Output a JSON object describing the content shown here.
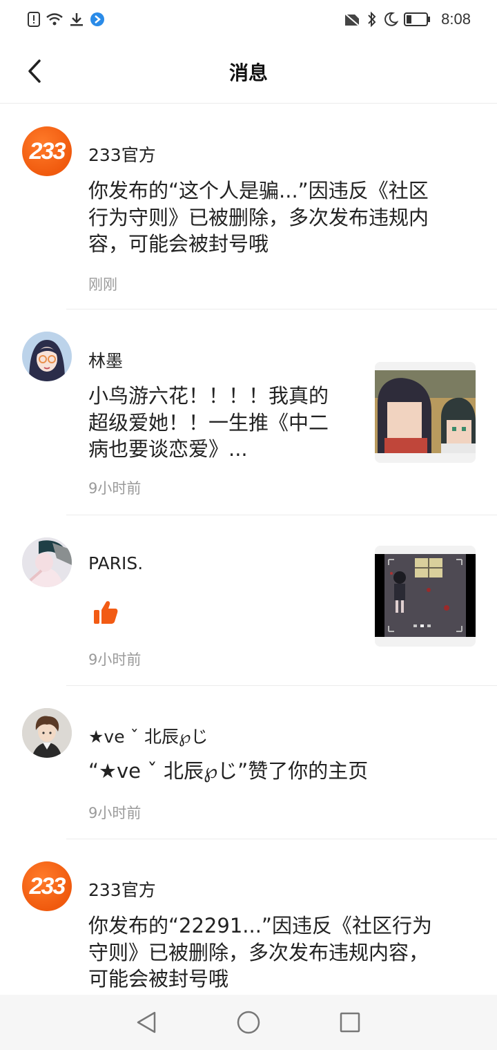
{
  "status_bar": {
    "time": "8:08",
    "left_icons": [
      "alert-icon",
      "wifi-icon",
      "download-icon",
      "app-notify-icon"
    ],
    "right_icons": [
      "no-sim-icon",
      "bluetooth-icon",
      "do-not-disturb-icon",
      "battery-icon"
    ]
  },
  "header": {
    "title": "消息",
    "back_icon": "chevron-left-icon"
  },
  "messages": [
    {
      "sender": "233官方",
      "avatar_text": "233",
      "body": "你发布的“这个人是骗...”因违反《社区行为守则》已被删除，多次发布违规内容，可能会被封号哦",
      "time": "刚刚"
    },
    {
      "sender": "林墨",
      "body": "小鸟游六花！！！！我真的超级爱她！！一生推《中二病也要谈恋爱》...",
      "time": "9小时前"
    },
    {
      "sender": "PARIS.⁣",
      "like_icon": "thumbs-up-icon",
      "time": "9小时前"
    },
    {
      "sender": "★ve ˇ 北辰℘じ",
      "body": "“★ve ˇ 北辰℘じ”赞了你的主页",
      "time": "9小时前"
    },
    {
      "sender": "233官方",
      "avatar_text": "233",
      "body": "你发布的“22291...”因违反《社区行为守则》已被删除，多次发布违规内容，可能会被封号哦"
    }
  ],
  "colors": {
    "brand_orange": "#f05a0e",
    "like_orange": "#f25b14",
    "secondary_text": "#9a9a9a",
    "divider": "#ececec"
  },
  "nav_bar": {
    "icons": [
      "nav-back-icon",
      "nav-home-icon",
      "nav-recents-icon"
    ]
  }
}
